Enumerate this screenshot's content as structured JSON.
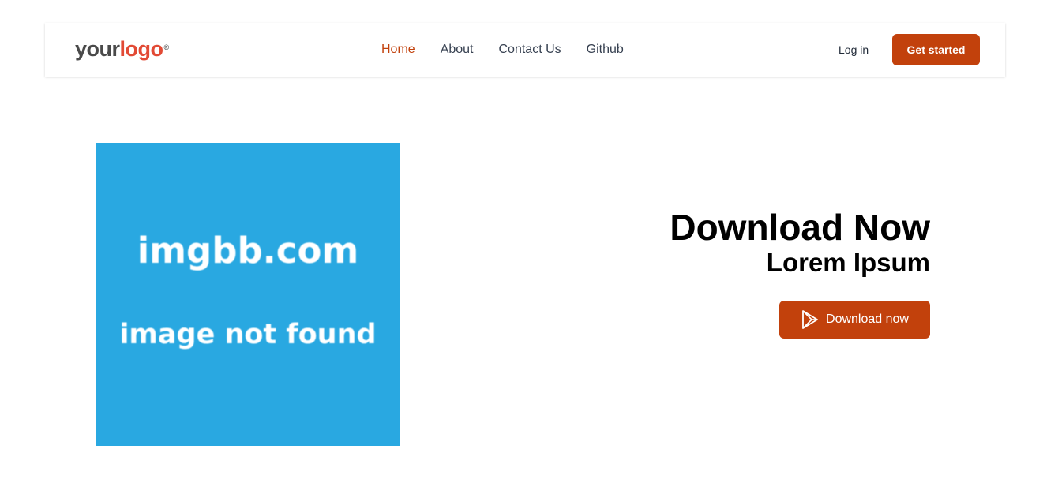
{
  "header": {
    "logo": {
      "part1": "your",
      "part2": "logo",
      "mark": "®"
    },
    "nav": [
      {
        "label": "Home",
        "active": true
      },
      {
        "label": "About",
        "active": false
      },
      {
        "label": "Contact Us",
        "active": false
      },
      {
        "label": "Github",
        "active": false
      }
    ],
    "login_label": "Log in",
    "cta_label": "Get started"
  },
  "hero": {
    "image": {
      "line1": "imgbb.com",
      "line2": "image not found",
      "color": "#29a8e1"
    },
    "title": "Download Now",
    "subtitle": "Lorem Ipsum",
    "download_label": "Download now",
    "download_icon": "play-store-icon"
  },
  "colors": {
    "accent": "#c2410c",
    "logo_accent": "#e24a35",
    "nav_text": "#374151"
  }
}
